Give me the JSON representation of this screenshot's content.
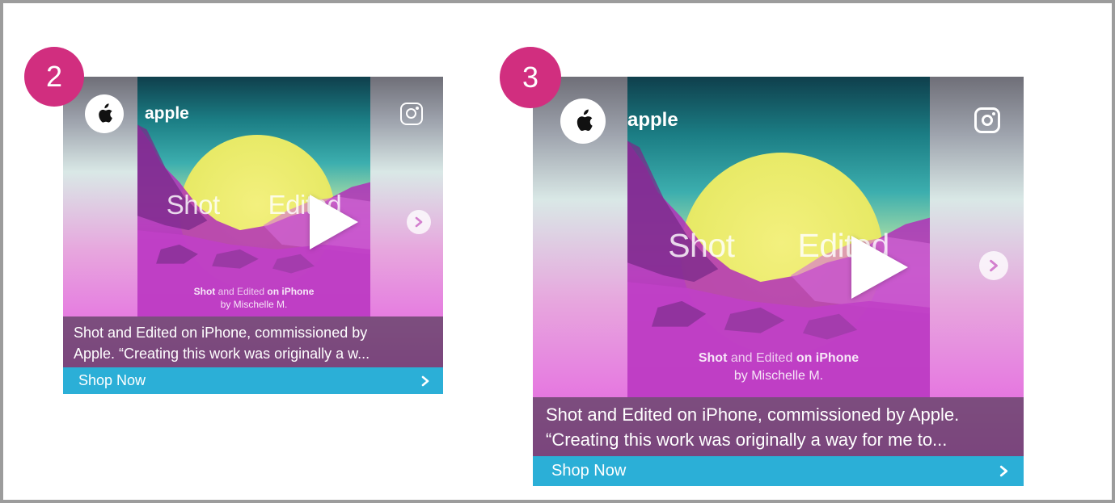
{
  "steps": [
    {
      "badge": "2",
      "account": "apple",
      "scene_title_left": "Shot",
      "scene_title_right": "Edited",
      "credit_shot": "Shot",
      "credit_mid": "and Edited",
      "credit_end": "on iPhone",
      "credit_by": "by Mischelle M.",
      "caption_line1": "Shot and Edited on iPhone, commissioned by",
      "caption_line2": "Apple. “Creating this work was originally a w...",
      "cta_label": "Shop Now"
    },
    {
      "badge": "3",
      "account": "apple",
      "scene_title_left": "Shot",
      "scene_title_right": "Edited",
      "credit_shot": "Shot",
      "credit_mid": "and Edited",
      "credit_end": "on iPhone",
      "credit_by": "by Mischelle M.",
      "caption_line1": "Shot and Edited on iPhone, commissioned by Apple.",
      "caption_line2": "“Creating this work was originally a way for me to...",
      "cta_label": "Shop Now"
    }
  ],
  "icons": {
    "avatar": "apple-logo-icon",
    "platform": "instagram-icon",
    "play": "play-icon",
    "next": "chevron-right-icon",
    "cta": "chevron-right-icon"
  },
  "colors": {
    "badge": "#d12e7f",
    "cta": "#2bafd7",
    "caption_bg": "#583e5c"
  }
}
